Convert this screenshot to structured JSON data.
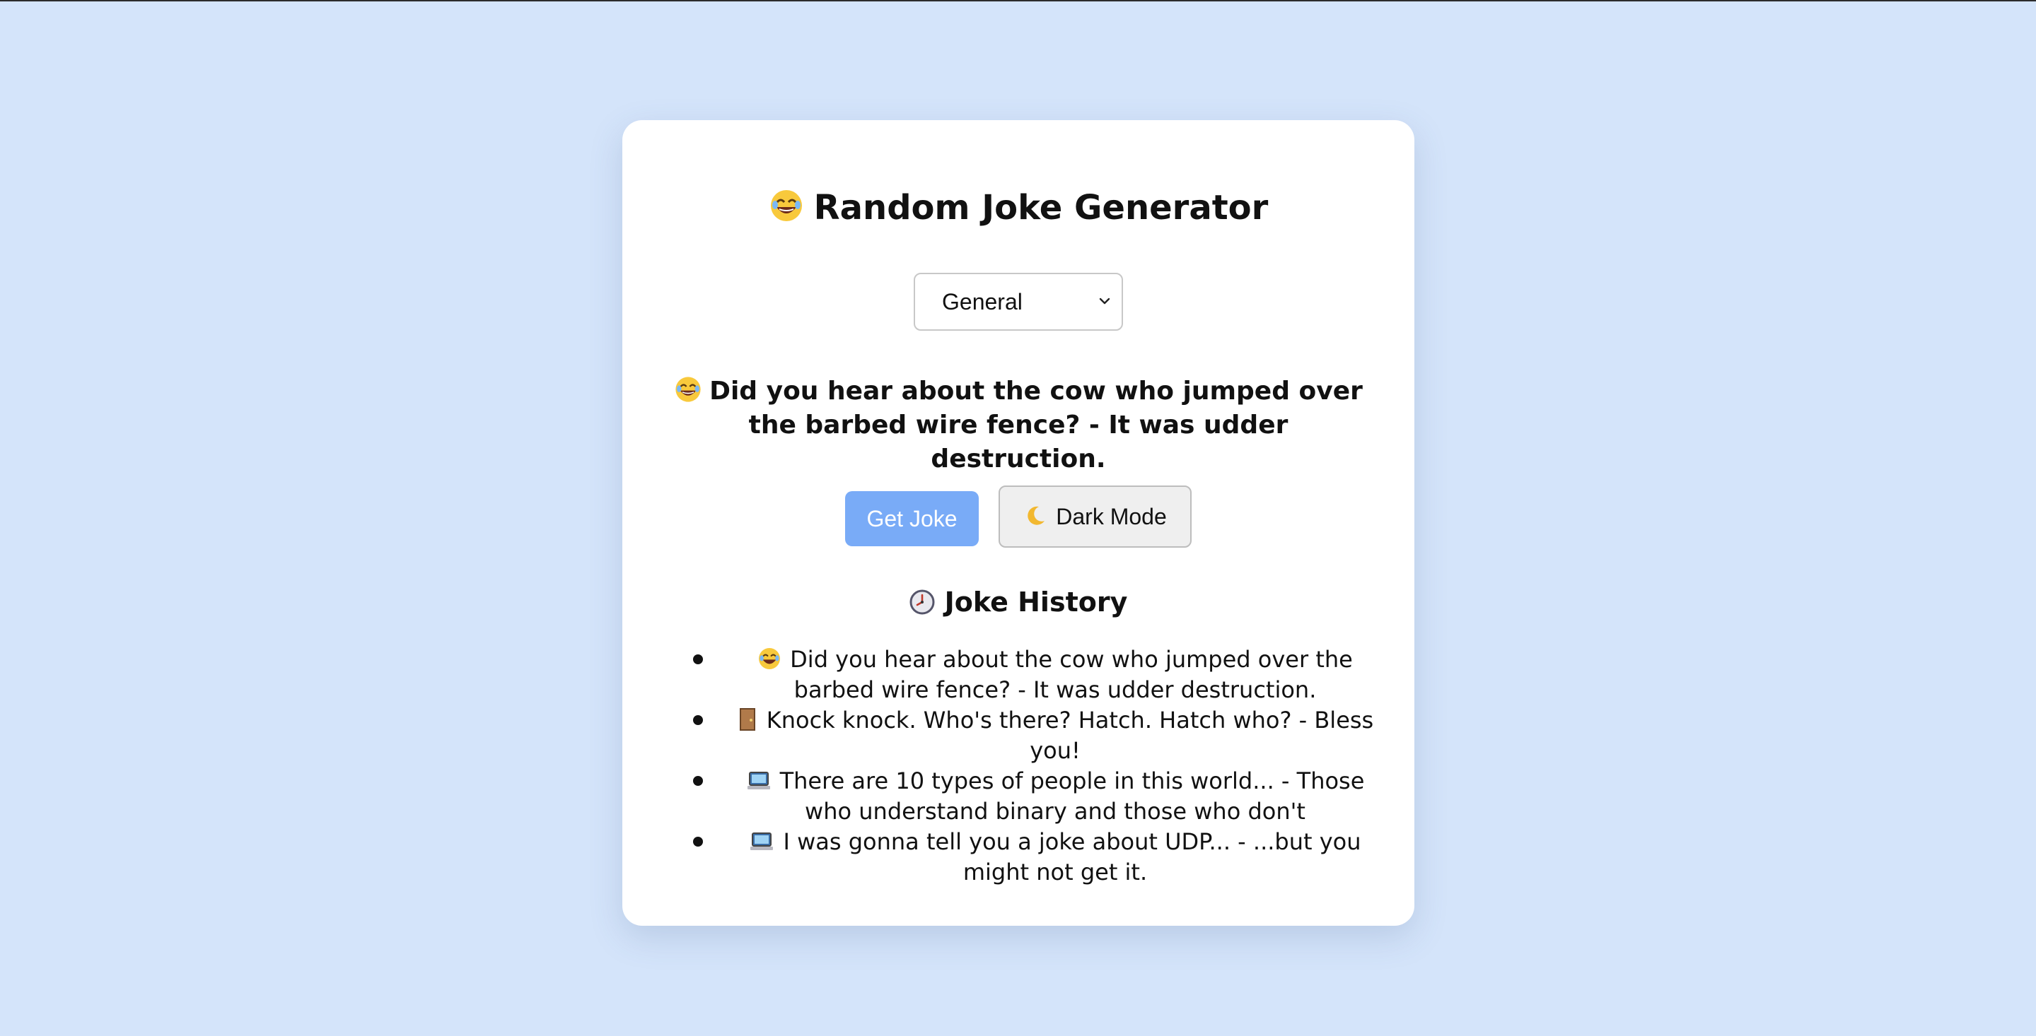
{
  "app": {
    "title": "Random Joke Generator",
    "title_icon": "laughing-face-icon"
  },
  "category_select": {
    "selected": "General",
    "icon": "chevron-down-icon"
  },
  "current_joke": {
    "icon": "laughing-face-icon",
    "text": "Did you hear about the cow who jumped over the barbed wire fence? - It was udder destruction."
  },
  "buttons": {
    "get_joke": "Get Joke",
    "dark_mode": "Dark Mode",
    "dark_mode_icon": "crescent-moon-icon"
  },
  "history": {
    "title": "Joke History",
    "title_icon": "clock-icon",
    "items": [
      {
        "icon": "laughing-face-icon",
        "text": "Did you hear about the cow who jumped over the barbed wire fence? - It was udder destruction."
      },
      {
        "icon": "door-icon",
        "text": "Knock knock. Who's there? Hatch. Hatch who? - Bless you!"
      },
      {
        "icon": "laptop-icon",
        "text": "There are 10 types of people in this world... - Those who understand binary and those who don't"
      },
      {
        "icon": "laptop-icon",
        "text": "I was gonna tell you a joke about UDP... - ...but you might not get it."
      }
    ]
  },
  "colors": {
    "background": "#d4e4fa",
    "card": "#ffffff",
    "primary_button": "#79abf7",
    "secondary_button": "#efefef"
  }
}
